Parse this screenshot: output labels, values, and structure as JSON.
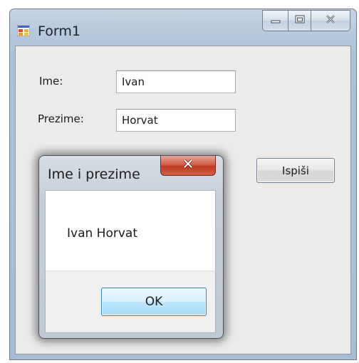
{
  "window": {
    "title": "Form1",
    "icon": "form-app-icon",
    "caption_buttons": [
      "minimize-icon",
      "maximize-icon",
      "close-icon"
    ]
  },
  "form": {
    "ime_label": "Ime:",
    "ime_value": "Ivan",
    "prezime_label": "Prezime:",
    "prezime_value": "Horvat",
    "ispisi_button": "Ispiši"
  },
  "message_box": {
    "title": "Ime i prezime",
    "message": "Ivan Horvat",
    "ok_button": "OK",
    "close_icon": "close-icon"
  },
  "colors": {
    "window_frame": "#b9cadd",
    "client_background": "#ebebea",
    "close_button_red": "#c9452d",
    "ok_button_blue": "#bee6fd"
  }
}
